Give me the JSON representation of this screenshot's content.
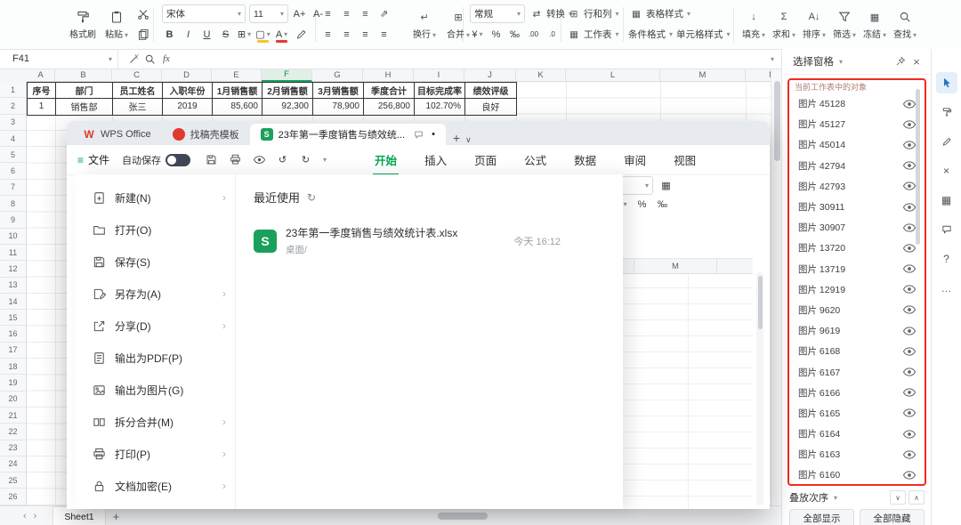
{
  "toolbar": {
    "format_painter": "格式刷",
    "paste": "粘贴",
    "font_name": "宋体",
    "font_size": "11",
    "a_plus": "A+",
    "a_minus": "A-",
    "bius": [
      "B",
      "I",
      "U",
      "S"
    ],
    "wrap": "换行",
    "merge": "合并",
    "number_format": "常规",
    "convert": "转换",
    "money": "¥",
    "percent": "%",
    "permille": "‰",
    "rows_cols": "行和列",
    "worksheet": "工作表",
    "table_style": "表格样式",
    "conditional_format": "条件格式",
    "cell_style": "单元格样式",
    "right_buttons": [
      "填充",
      "求和",
      "排序",
      "筛选",
      "冻结",
      "查找"
    ]
  },
  "formula_bar": {
    "name_box": "F41",
    "fx": "fx"
  },
  "sheet": {
    "columns": [
      "A",
      "B",
      "C",
      "D",
      "E",
      "F",
      "G",
      "H",
      "I",
      "J",
      "K",
      "L",
      "M",
      "N"
    ],
    "selected_column": "F",
    "row_count": 26,
    "table": {
      "headers": [
        "序号",
        "部门",
        "员工姓名",
        "入职年份",
        "1月销售额",
        "2月销售额",
        "3月销售额",
        "季度合计",
        "目标完成率",
        "绩效评级"
      ],
      "rows": [
        [
          "1",
          "销售部",
          "张三",
          "2019",
          "85,600",
          "92,300",
          "78,900",
          "256,800",
          "102.70%",
          "良好"
        ]
      ]
    },
    "sheet_tab": "Sheet1"
  },
  "popup": {
    "tabs": [
      {
        "label": "WPS Office",
        "icon": "wps"
      },
      {
        "label": "找稿壳模板",
        "icon": "template"
      },
      {
        "label": "23年第一季度销售与绩效统...",
        "icon": "sheet",
        "active": true
      }
    ],
    "menu_bar": {
      "file": "文件",
      "autosave": "自动保存",
      "ribbon_tabs": [
        "开始",
        "插入",
        "页面",
        "公式",
        "数据",
        "审阅",
        "视图"
      ],
      "active_tab": "开始"
    },
    "file_menu": [
      {
        "label": "新建(N)",
        "icon": "new",
        "arrow": true
      },
      {
        "label": "打开(O)",
        "icon": "open",
        "arrow": false
      },
      {
        "label": "保存(S)",
        "icon": "save",
        "arrow": false
      },
      {
        "label": "另存为(A)",
        "icon": "saveas",
        "arrow": true
      },
      {
        "label": "分享(D)",
        "icon": "share",
        "arrow": true
      },
      {
        "label": "输出为PDF(P)",
        "icon": "pdf",
        "arrow": false
      },
      {
        "label": "输出为图片(G)",
        "icon": "image",
        "arrow": false
      },
      {
        "label": "拆分合并(M)",
        "icon": "split",
        "arrow": true
      },
      {
        "label": "打印(P)",
        "icon": "print",
        "arrow": true
      },
      {
        "label": "文档加密(E)",
        "icon": "lock",
        "arrow": true
      }
    ],
    "recent": {
      "title": "最近使用",
      "files": [
        {
          "name": "23年第一季度销售与绩效统计表.xlsx",
          "path": "桌面/",
          "time": "今天 16:12"
        }
      ]
    },
    "fragment": {
      "wrap": "换行",
      "merge": "合并",
      "number_format": "常规",
      "percent": "%",
      "permille": "‰",
      "grid_columns": [
        "L",
        "M"
      ]
    }
  },
  "selection_pane": {
    "title": "选择窗格",
    "subtitle": "当前工作表中的对象",
    "items": [
      "图片 45128",
      "图片 45127",
      "图片 45014",
      "图片 42794",
      "图片 42793",
      "图片 30911",
      "图片 30907",
      "图片 13720",
      "图片 13719",
      "图片 12919",
      "图片 9620",
      "图片 9619",
      "图片 6168",
      "图片 6167",
      "图片 6166",
      "图片 6165",
      "图片 6164",
      "图片 6163",
      "图片 6160"
    ],
    "stack_order": "叠放次序",
    "show_all": "全部显示",
    "hide_all": "全部隐藏"
  },
  "colors": {
    "brand_green": "#00a650",
    "sheet_green": "#1aa05a",
    "highlight_red": "#f42a1e"
  }
}
